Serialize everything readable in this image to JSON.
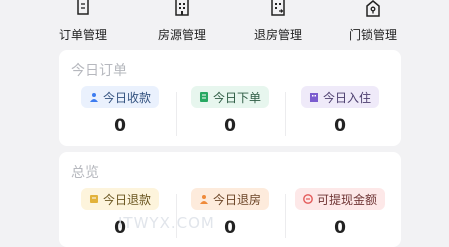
{
  "nav": {
    "items": [
      {
        "label": "订单管理",
        "icon": "order-icon"
      },
      {
        "label": "房源管理",
        "icon": "building-icon"
      },
      {
        "label": "退房管理",
        "icon": "checkout-building-icon"
      },
      {
        "label": "门锁管理",
        "icon": "door-lock-icon"
      }
    ]
  },
  "today": {
    "title": "今日订单",
    "stats": [
      {
        "label": "今日收款",
        "value": "0",
        "icon": "payment-icon",
        "color": "#3d7cf0"
      },
      {
        "label": "今日下单",
        "value": "0",
        "icon": "new-order-icon",
        "color": "#27a862"
      },
      {
        "label": "今日入住",
        "value": "0",
        "icon": "checkin-icon",
        "color": "#7b5ccf"
      }
    ]
  },
  "overview": {
    "title": "总览",
    "stats": [
      {
        "label": "今日退款",
        "value": "0",
        "icon": "refund-icon",
        "color": "#e2b23a"
      },
      {
        "label": "今日退房",
        "value": "0",
        "icon": "checkout-person-icon",
        "color": "#ef8a3a"
      },
      {
        "label": "可提现金额",
        "value": "0",
        "icon": "withdraw-icon",
        "color": "#e35a5a"
      }
    ]
  },
  "watermark": "ITWYX.COM"
}
